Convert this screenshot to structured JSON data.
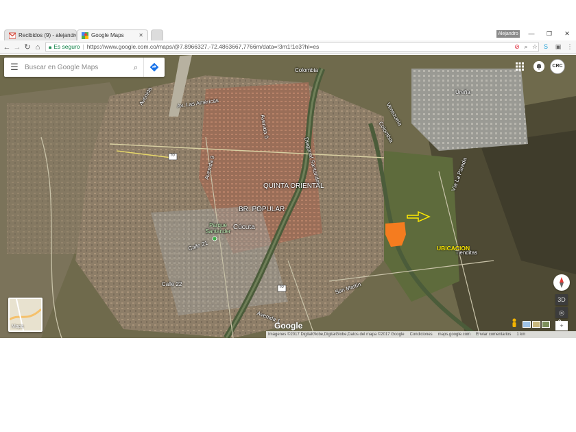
{
  "browser": {
    "tabs": [
      {
        "label": "Recibidos (9) - alejandro",
        "icon": "gmail-icon",
        "active": false
      },
      {
        "label": "Google Maps",
        "icon": "google-maps-icon",
        "active": true
      }
    ],
    "user_chip": "Alejandro",
    "address": {
      "secure_label": "Es seguro",
      "url": "https://www.google.com.co/maps/@7.8966327,-72.4863667,7766m/data=!3m1!1e3?hl=es"
    }
  },
  "search": {
    "placeholder": "Buscar en Google Maps"
  },
  "account": {
    "avatar_text": "CRC"
  },
  "map": {
    "mode": "satellite",
    "labels": {
      "colombia_1": "Colombia",
      "venezuela": "Venezuela",
      "colombia_2": "Colombia",
      "urena": "Ureña",
      "av_america": "Av. Las Américas",
      "quinta_oriental": "QUINTA ORIENTAL",
      "br_popular": "BR. POPULAR",
      "cucuta": "Cúcuta",
      "parque_santander": "Parque Santander",
      "calle_21": "Calle 21",
      "calle_22": "Calle 22",
      "san_martin": "San Martín",
      "tienditas": "Tienditas",
      "route_70a": "70",
      "route_70b": "70",
      "avenida_a": "Avenida",
      "avenida_9": "Avenida 9",
      "avenida_0": "Avenida 0",
      "diagonal": "Diagonal Santander",
      "via_la_parada": "Vía La Parada",
      "avenida_1": "Avenida 1"
    },
    "ubicacion_label": "UBICACION",
    "marker_color": "#f57c1f",
    "arrow_color": "#ffeb00",
    "google_logo": "Google",
    "minimap_label": "Mapa",
    "controls": {
      "threeD": "3D",
      "zoom_in": "+",
      "zoom_out": "−",
      "expand": "⌃"
    },
    "footer": {
      "imagery": "Imágenes ©2017 DigitalGlobe,DigitalGlobe,Datos del mapa ©2017 Google",
      "terms": "Condiciones",
      "site": "maps.google.com",
      "feedback": "Enviar comentarios",
      "scale": "1 km"
    }
  }
}
